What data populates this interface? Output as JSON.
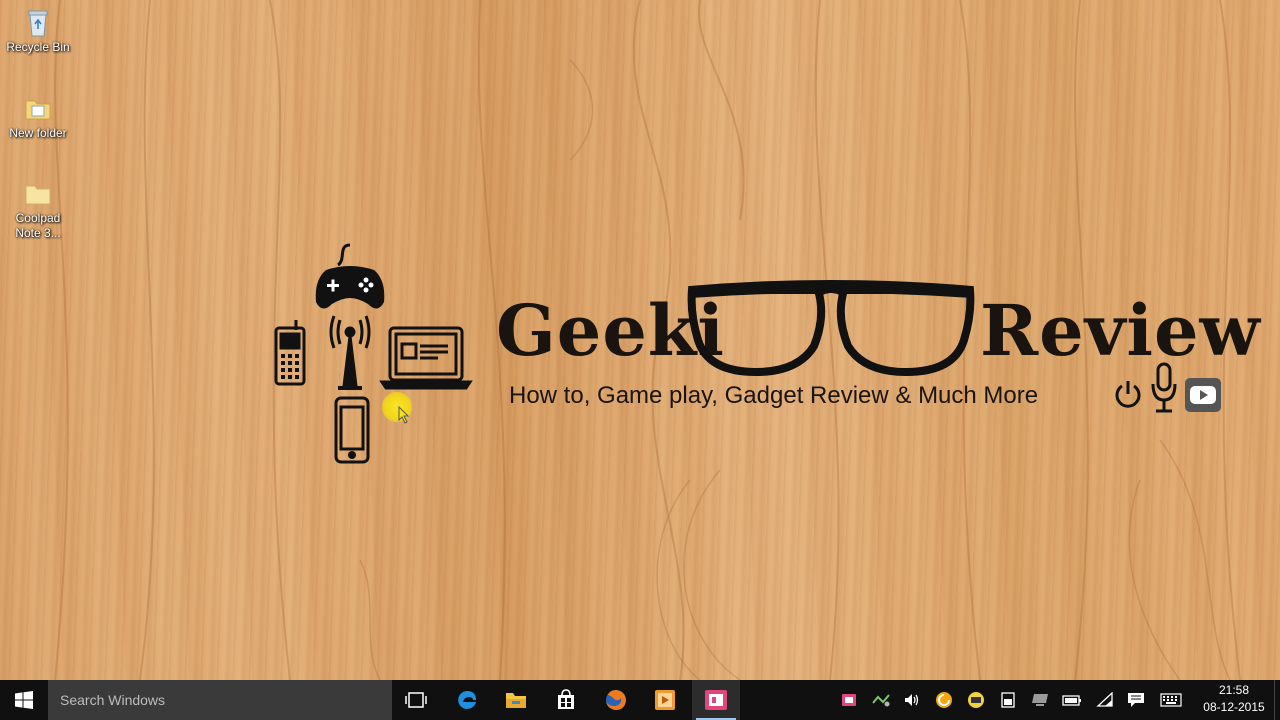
{
  "desktop": {
    "icons": [
      {
        "label": "Recycle Bin"
      },
      {
        "label": "New folder"
      },
      {
        "label": "Coolpad\nNote 3..."
      }
    ]
  },
  "banner": {
    "title_left": "Geeki",
    "title_right": "Review",
    "subtitle": "How to, Game play, Gadget Review  & Much More"
  },
  "taskbar": {
    "search_placeholder": "Search Windows",
    "apps": [
      "task-view",
      "edge",
      "file-explorer",
      "store",
      "firefox",
      "media-player",
      "presentation-app"
    ],
    "tray_icons": [
      "tray-app-icon",
      "network-activity-icon",
      "volume-icon",
      "updater-icon",
      "chat-icon",
      "battery-meter-icon",
      "display-icon",
      "power-icon",
      "wifi-icon",
      "action-center-icon",
      "keyboard-icon"
    ],
    "clock": {
      "time": "21:58",
      "date": "08-12-2015"
    }
  },
  "colors": {
    "taskbar_bg": "#101010",
    "search_bg": "#3a3a3a",
    "active_underline": "#9bc7ee",
    "banner_ink": "#1a1410",
    "cursor_highlight": "#f6e21a"
  }
}
